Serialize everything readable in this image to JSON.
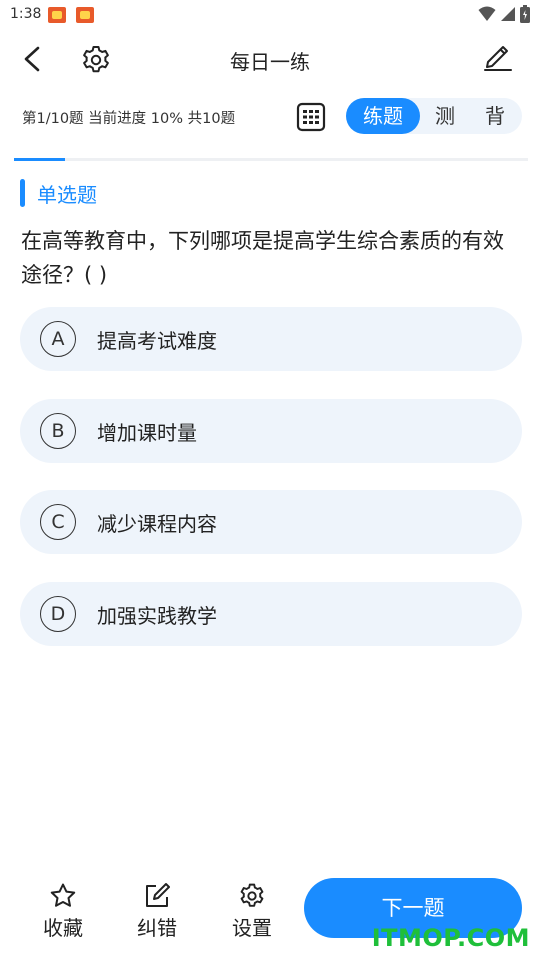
{
  "status_bar": {
    "time": "1:38"
  },
  "app_bar": {
    "title": "每日一练"
  },
  "progress": {
    "text": "第1/10题 当前进度 10% 共10题",
    "fraction": 0.1
  },
  "modes": {
    "practice": "练题",
    "test": "测",
    "recite": "背",
    "active": "practice"
  },
  "question": {
    "type_label": "单选题",
    "text": "在高等教育中，下列哪项是提高学生综合素质的有效途径？( )",
    "options": [
      {
        "letter": "A",
        "text": "提高考试难度"
      },
      {
        "letter": "B",
        "text": "增加课时量"
      },
      {
        "letter": "C",
        "text": "减少课程内容"
      },
      {
        "letter": "D",
        "text": "加强实践教学"
      }
    ]
  },
  "bottom_bar": {
    "favorite": "收藏",
    "report_error": "纠错",
    "settings": "设置",
    "next": "下一题"
  },
  "watermark": "ITMOP.COM",
  "colors": {
    "accent": "#1a8cff",
    "option_bg": "#eef4fb",
    "watermark": "#1fbf3a"
  }
}
